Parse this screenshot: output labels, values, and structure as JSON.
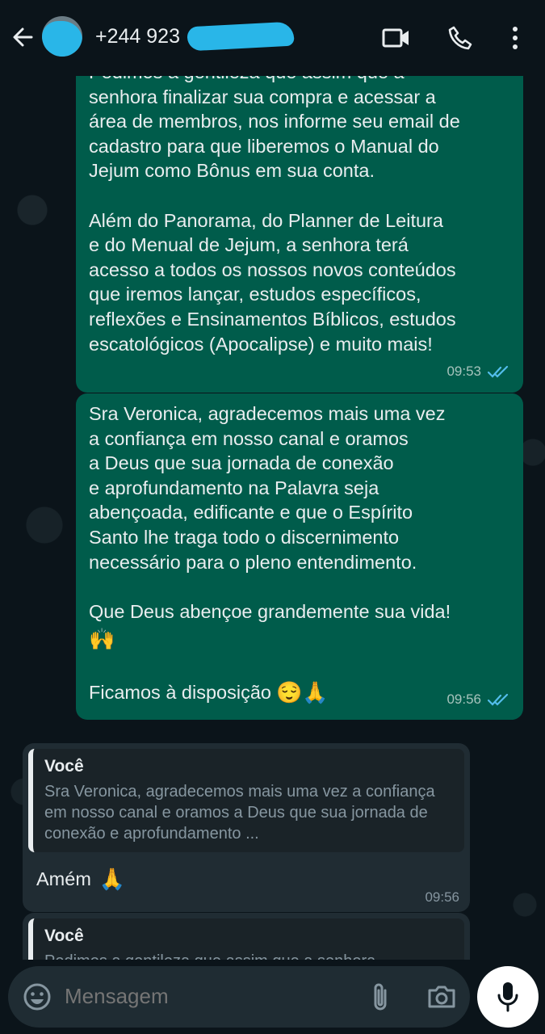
{
  "header": {
    "contact": "+244 923",
    "back_icon": "arrow-left-icon",
    "video_icon": "video-call-icon",
    "call_icon": "phone-icon",
    "menu_icon": "more-vertical-icon"
  },
  "messages": [
    {
      "type": "out",
      "text": "Pedimos a gentileza que assim que a\nsenhora finalizar sua compra e acessar a\nárea de membros, nos informe seu email de\ncadastro para que liberemos o Manual do\nJejum como Bônus em sua conta.\n\nAlém do Panorama, do Planner de Leitura\ne do Menual de Jejum, a senhora terá\nacesso a todos os nossos novos conteúdos\nque iremos lançar,  estudos específicos,\nreflexões e Ensinamentos Bíblicos, estudos\nescatológicos (Apocalipse) e muito mais!",
      "time": "09:53",
      "status": "read"
    },
    {
      "type": "out",
      "text": "Sra Veronica, agradecemos mais uma vez\na confiança em nosso canal e oramos\na Deus que sua jornada de conexão\ne aprofundamento na Palavra seja\nabençoada, edificante e  que o Espírito\nSanto lhe traga todo o discernimento\nnecessário para o pleno entendimento.\n\nQue Deus abençoe grandemente sua vida!",
      "emoji_line": "🙌",
      "closing": "Ficamos à disposição",
      "closing_emojis": "😌🙏",
      "time": "09:56",
      "status": "read"
    },
    {
      "type": "in",
      "quote_author": "Você",
      "quote_text": "Sra Veronica, agradecemos mais uma vez a confiança em nosso canal e oramos a Deus que sua jornada de conexão e aprofundamento ...",
      "text": "Amém",
      "emoji": "🙏",
      "time": "09:56"
    },
    {
      "type": "in",
      "quote_author": "Você",
      "quote_text": "Pedimos a gentileza que assim que a senhora"
    }
  ],
  "input": {
    "placeholder": "Mensagem",
    "emoji_icon": "emoji-icon",
    "attach_icon": "paperclip-icon",
    "camera_icon": "camera-icon",
    "mic_icon": "microphone-icon"
  },
  "colors": {
    "background": "#0b141a",
    "outgoing_bubble": "#005c4b",
    "incoming_bubble": "#202c33",
    "read_ticks": "#53bdeb"
  }
}
